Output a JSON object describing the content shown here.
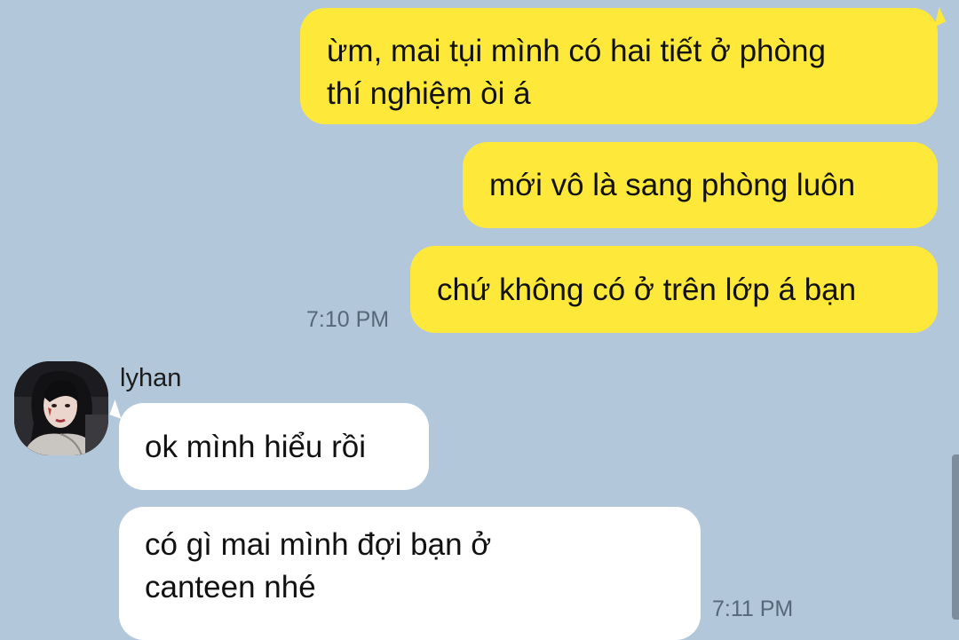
{
  "messages_out": [
    {
      "text": "ừm, mai tụi mình có hai tiết ở phòng\nthí nghiệm òi á"
    },
    {
      "text": "mới vô là sang phòng luôn"
    },
    {
      "text": "chứ không có ở trên lớp á bạn"
    }
  ],
  "time_out": "7:10 PM",
  "sender": {
    "name": "lyhan",
    "avatar_icon": "user-avatar-photo"
  },
  "messages_in": [
    {
      "text": "ok mình hiểu rồi"
    },
    {
      "text": "có gì mai mình đợi bạn ở\ncanteen nhé"
    }
  ],
  "time_in": "7:11 PM",
  "colors": {
    "background": "#b2c7da",
    "outgoing_bubble": "#fee93a",
    "incoming_bubble": "#ffffff",
    "timestamp": "#56687a"
  }
}
